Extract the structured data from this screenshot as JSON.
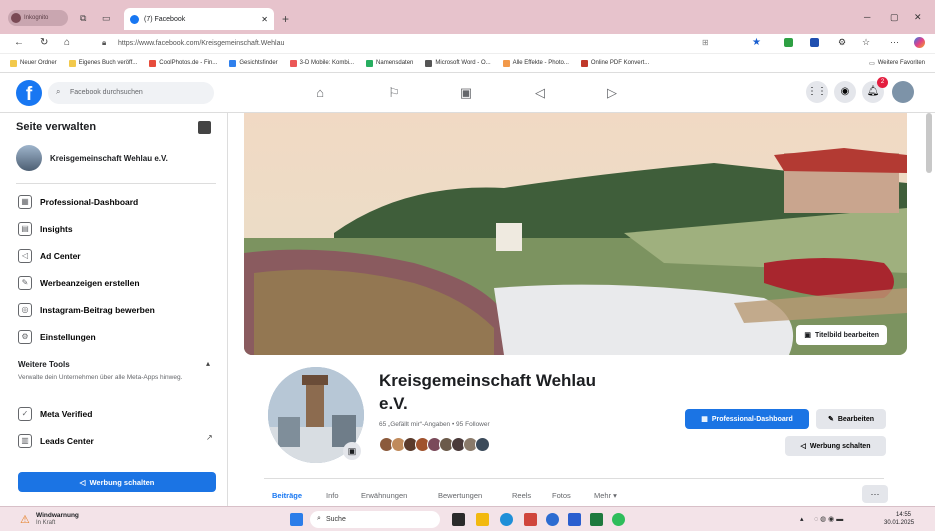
{
  "browser": {
    "profile_label": "Inkognito",
    "tab_title": "(7) Facebook",
    "url": "https://www.facebook.com/Kreisgemeinschaft.Wehlau",
    "bookmarks": [
      {
        "label": "Neuer Ordner",
        "color": "#f2c94c"
      },
      {
        "label": "Eigenes Buch veröff...",
        "color": "#f2c94c"
      },
      {
        "label": "CoolPhotos.de - Fin...",
        "color": "#e74c3c"
      },
      {
        "label": "Gesichtsfinder",
        "color": "#2f80ed"
      },
      {
        "label": "3-D Mobile: Kombi...",
        "color": "#eb5757"
      },
      {
        "label": "Namensdaten",
        "color": "#27ae60"
      },
      {
        "label": "Microsoft Word - O...",
        "color": "#555555"
      },
      {
        "label": "Alle Effekte - Photo...",
        "color": "#f2994a"
      },
      {
        "label": "Online PDF Konvert...",
        "color": "#c0392b"
      }
    ],
    "other_bookmarks": "Weitere Favoriten"
  },
  "fb": {
    "logo": "f",
    "search_placeholder": "Facebook durchsuchen",
    "notif_count": "2"
  },
  "sidebar": {
    "title": "Seite verwalten",
    "page_name": "Kreisgemeinschaft Wehlau e.V.",
    "items": [
      {
        "label": "Professional-Dashboard",
        "icon": "dashboard-icon",
        "glyph": "▦"
      },
      {
        "label": "Insights",
        "icon": "insights-icon",
        "glyph": "▤"
      },
      {
        "label": "Ad Center",
        "icon": "megaphone-icon",
        "glyph": "◁"
      },
      {
        "label": "Werbeanzeigen erstellen",
        "icon": "edit-icon",
        "glyph": "✎"
      },
      {
        "label": "Instagram-Beitrag bewerben",
        "icon": "instagram-icon",
        "glyph": "◎"
      },
      {
        "label": "Einstellungen",
        "icon": "gear-icon",
        "glyph": "⚙"
      }
    ],
    "more_tools_title": "Weitere Tools",
    "more_tools_desc": "Verwalte dein Unternehmen über alle Meta-Apps hinweg.",
    "tools": [
      {
        "label": "Meta Verified",
        "icon": "verified-icon",
        "glyph": "✓"
      },
      {
        "label": "Leads Center",
        "icon": "leads-icon",
        "glyph": "▥"
      }
    ],
    "promote_button": "Werbung schalten"
  },
  "page": {
    "cover_edit": "Titelbild bearbeiten",
    "name_line1": "Kreisgemeinschaft Wehlau",
    "name_line2": "e.V.",
    "stats": "65 „Gefällt mir“-Angaben • 95 Follower",
    "btn_dashboard": "Professional-Dashboard",
    "btn_edit": "Bearbeiten",
    "btn_promote": "Werbung schalten",
    "tabs": [
      "Beiträge",
      "Info",
      "Erwähnungen",
      "Bewertungen",
      "Reels",
      "Fotos",
      "Mehr ▾"
    ],
    "friend_colors": [
      "#8b5a3c",
      "#c08a5b",
      "#5b3a2b",
      "#a0522d",
      "#7a4a5a",
      "#6b5a4a",
      "#4a3a3a",
      "#8a7a6a",
      "#3b4a5a"
    ]
  },
  "taskbar": {
    "weather_title": "Windwarnung",
    "weather_sub": "In Kraft",
    "search": "Suche",
    "time": "14:55",
    "date": "30.01.2025"
  }
}
